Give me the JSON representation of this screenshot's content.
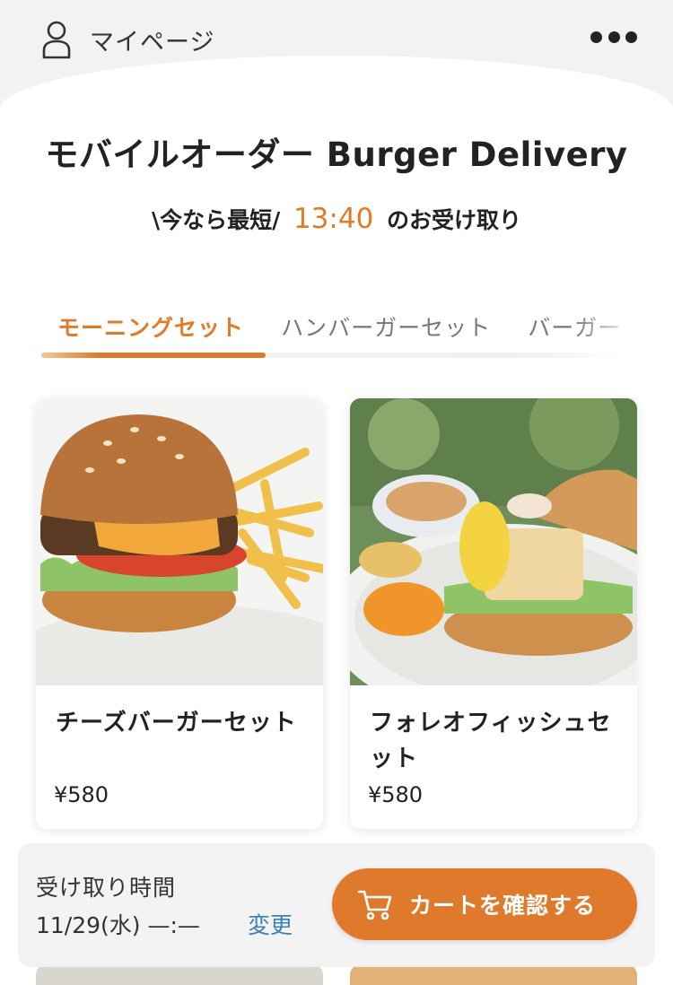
{
  "header": {
    "mypage_label": "マイページ",
    "more_icon": "more-horizontal-icon"
  },
  "title": "モバイルオーダー Burger Delivery",
  "pickup_notice": {
    "prefix": "\\今なら最短/",
    "time": "13:40",
    "suffix": "のお受け取り"
  },
  "tabs": [
    {
      "label": "モーニングセット",
      "active": true
    },
    {
      "label": "ハンバーガーセット",
      "active": false
    },
    {
      "label": "バーガー",
      "active": false
    }
  ],
  "products": [
    {
      "name": "チーズバーガーセット",
      "price": "¥580",
      "image": "cheeseburger-set-photo"
    },
    {
      "name": "フォレオフィッシュセット",
      "price": "¥580",
      "image": "fish-burger-set-photo"
    }
  ],
  "pickup_bar": {
    "label": "受け取り時間",
    "value": "11/29(水) —:—",
    "change_label": "変更"
  },
  "cart_button": {
    "label": "カートを確認する",
    "icon": "cart-icon"
  },
  "colors": {
    "accent": "#e07b2a",
    "link": "#3b7fb8",
    "background": "#f2f2f2"
  }
}
